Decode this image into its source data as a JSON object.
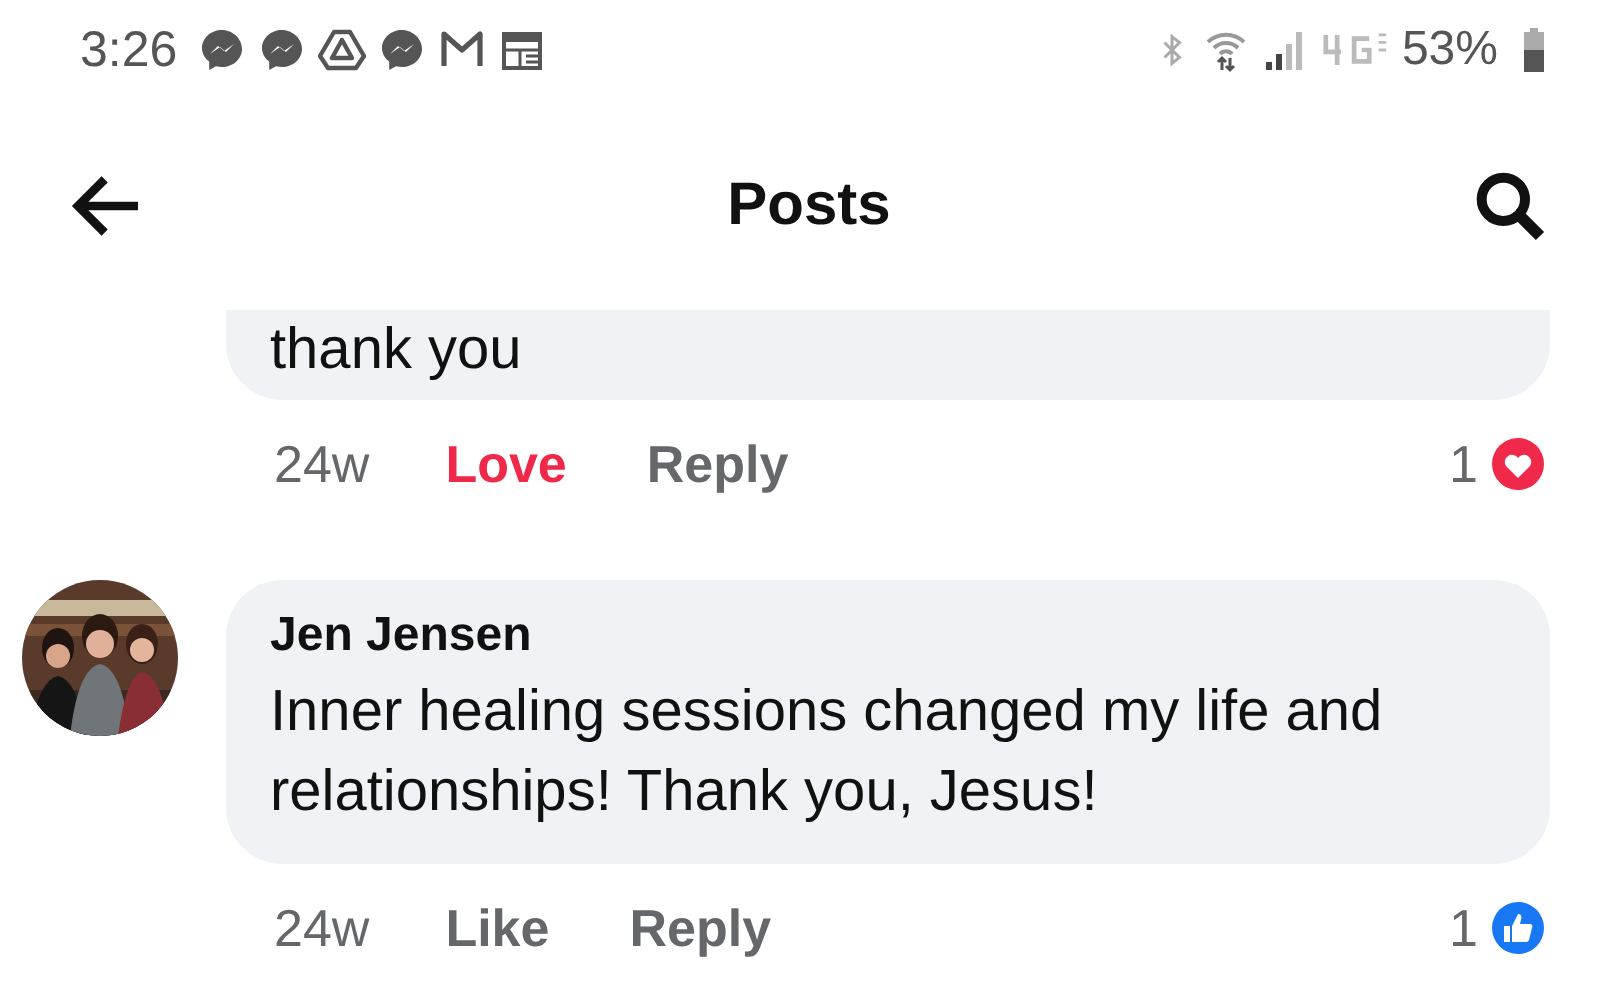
{
  "status_bar": {
    "time": "3:26",
    "battery": "53%"
  },
  "header": {
    "title": "Posts"
  },
  "comments": [
    {
      "text": "thank you",
      "age": "24w",
      "reaction_label": "Love",
      "reacted": true,
      "kind": "love",
      "reply": "Reply",
      "count": "1"
    },
    {
      "author": "Jen Jensen",
      "text": "Inner healing sessions changed my life and relationships! Thank you, Jesus!",
      "age": "24w",
      "reaction_label": "Like",
      "reacted": false,
      "kind": "like",
      "reply": "Reply",
      "count": "1"
    }
  ]
}
